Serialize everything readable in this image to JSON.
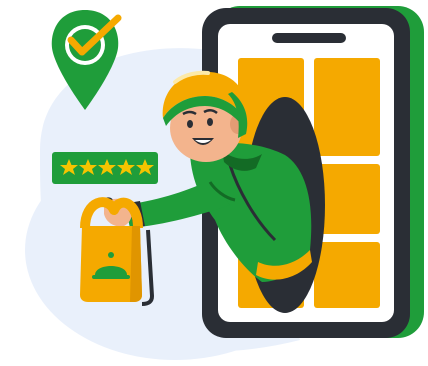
{
  "illustration": {
    "rating_stars": 5,
    "tiles_count": 6,
    "colors": {
      "green": "#1f9d3a",
      "green_dark": "#136b25",
      "gold": "#f5a900",
      "dark": "#2a2e35",
      "skin": "#f3b48d",
      "blue_bg": "#e8f0fb"
    },
    "icons": [
      "location-pin-check-icon",
      "star-rating-icon",
      "smartphone-icon",
      "delivery-courier-icon",
      "food-bag-cloche-icon"
    ]
  }
}
